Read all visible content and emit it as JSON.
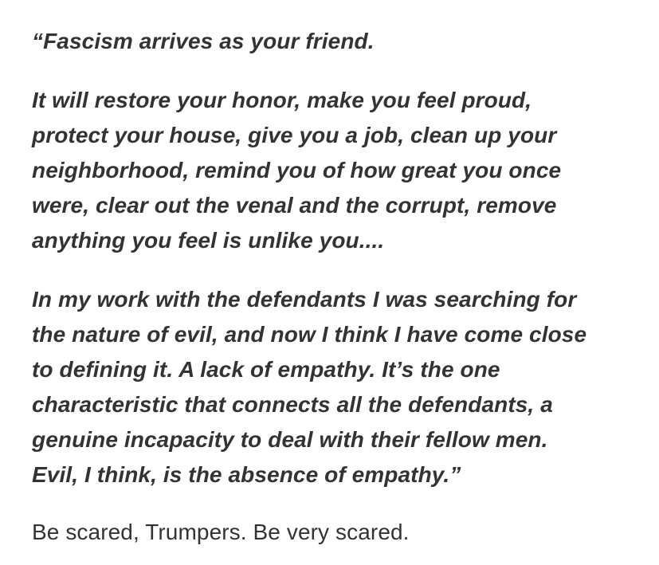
{
  "document": {
    "paragraphs": [
      {
        "style": "italic-bold",
        "lines": [
          "“Fascism arrives as your friend."
        ]
      },
      {
        "style": "italic-bold",
        "lines": [
          "It will restore your honor, make you feel proud,",
          "protect your house, give you a job, clean up your",
          "neighborhood, remind you of how great you once",
          "were, clear out the venal and the corrupt, remove",
          "anything you feel is unlike you...."
        ]
      },
      {
        "style": "italic-bold",
        "lines": [
          "In my work with the defendants I was searching for",
          "the nature of evil, and now I think I have come close",
          "to defining it. A lack of empathy. It’s the one",
          "characteristic that connects all the defendants, a",
          "genuine incapacity to deal with their fellow men.",
          "Evil, I think, is the absence of empathy.”"
        ]
      },
      {
        "style": "regular",
        "lines": [
          "Be scared, Trumpers. Be very scared."
        ]
      }
    ]
  },
  "colors": {
    "text": "#333333",
    "background": "#ffffff"
  }
}
